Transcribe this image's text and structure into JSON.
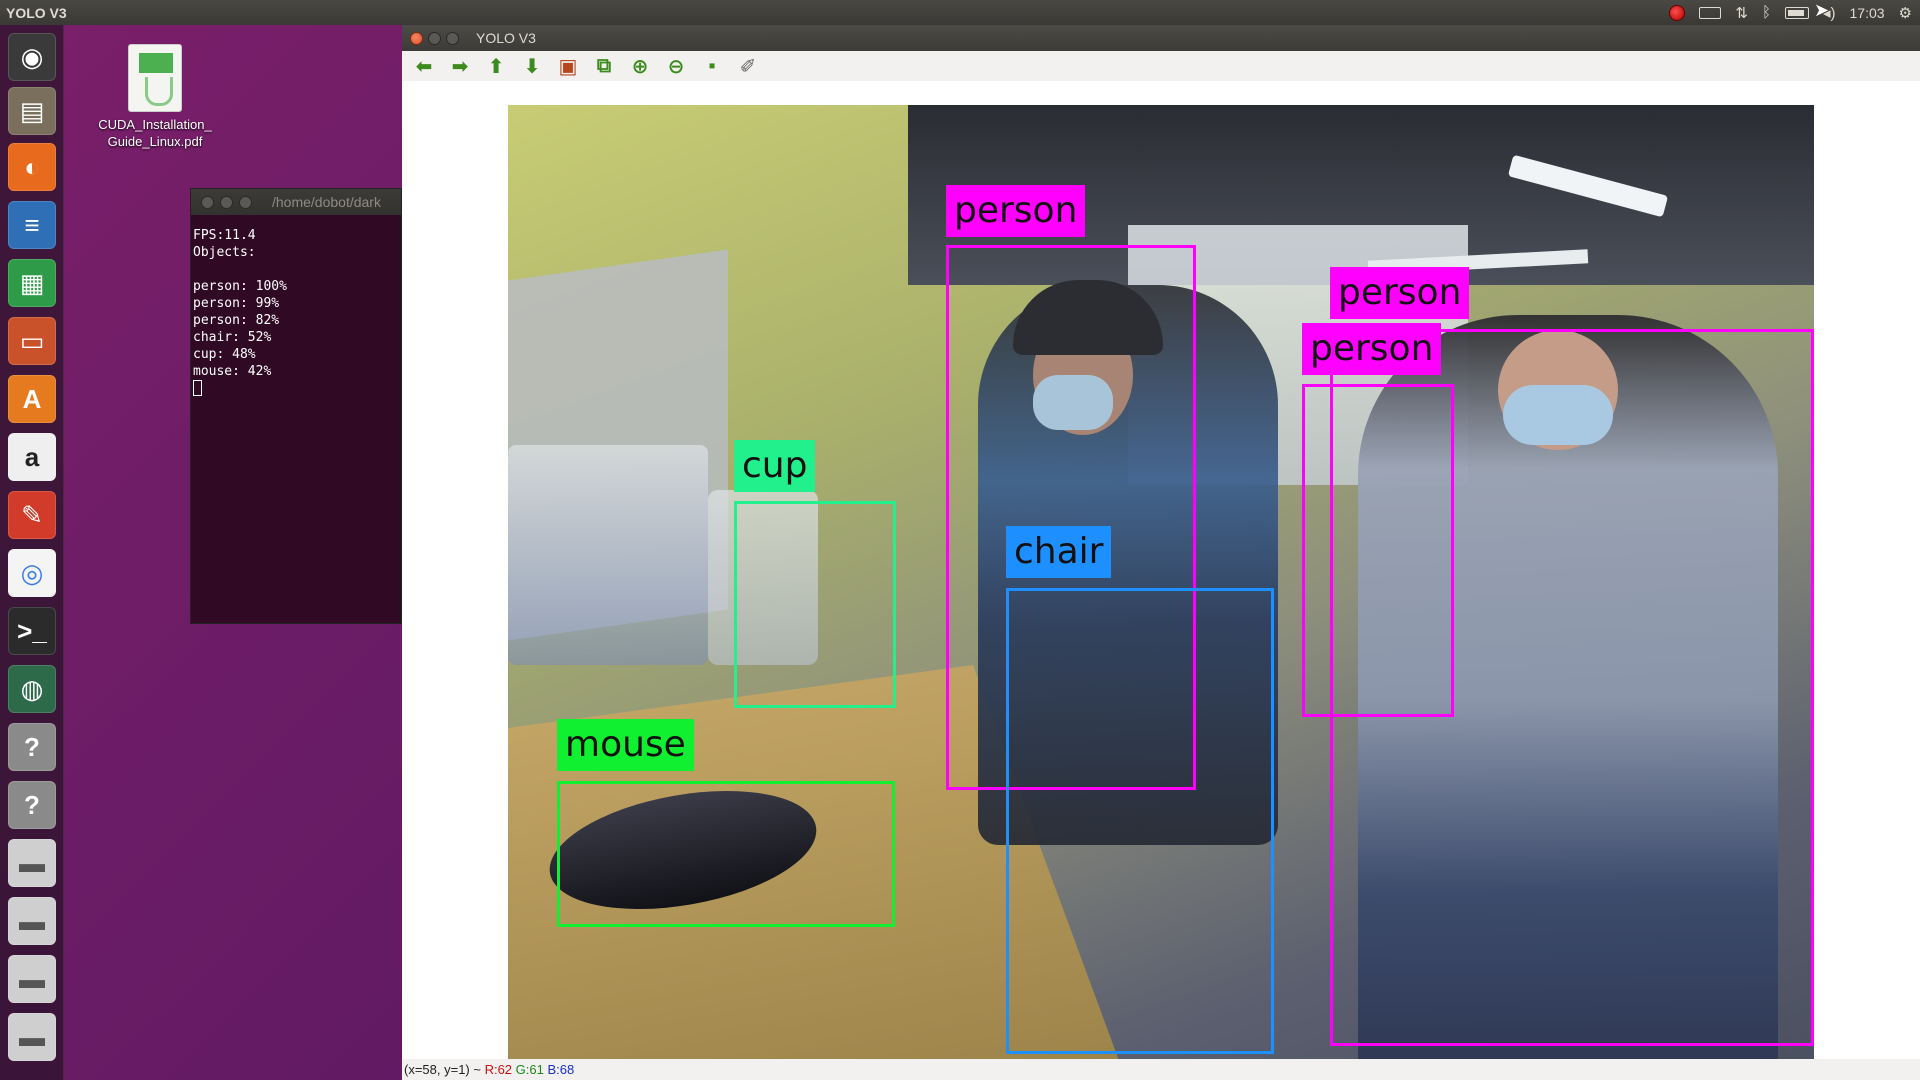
{
  "top_panel": {
    "app_title": "YOLO V3",
    "clock": "17:03",
    "indicators": [
      "record-icon",
      "keyboard-icon",
      "network-icon",
      "bluetooth-icon",
      "battery-icon",
      "volume-icon",
      "gear-icon"
    ]
  },
  "launcher": {
    "items": [
      "ubuntu-dash-icon",
      "files-icon",
      "firefox-icon",
      "writer-icon",
      "calc-icon",
      "impress-icon",
      "software-center-icon",
      "amazon-icon",
      "system-settings-icon",
      "chrome-icon",
      "terminal-icon",
      "globe-icon",
      "unknown-app-icon",
      "unknown-app-icon",
      "drive-icon",
      "drive-icon",
      "drive-icon",
      "drive-icon"
    ]
  },
  "desktop": {
    "file_name": "CUDA_Installation_\nGuide_Linux.pdf"
  },
  "terminal": {
    "title": "/home/dobot/dark",
    "lines": "FPS:11.4\nObjects:\n\nperson: 100%\nperson: 99%\nperson: 82%\nchair: 52%\ncup: 48%\nmouse: 42%"
  },
  "yolo_window": {
    "title": "YOLO V3",
    "toolbar": [
      "left-arrow-icon",
      "right-arrow-icon",
      "up-arrow-icon",
      "down-arrow-icon",
      "image-icon",
      "zoom-fit-icon",
      "zoom-in-icon",
      "zoom-out-icon",
      "save-icon",
      "brush-icon"
    ],
    "status": {
      "coords": "(x=58, y=1) ~ ",
      "r": "R:62",
      "g": "G:61",
      "b": "B:68"
    }
  },
  "detections": [
    {
      "label": "person",
      "color": "#ff00ff"
    },
    {
      "label": "person",
      "color": "#ff00ff"
    },
    {
      "label": "person",
      "color": "#ff00ff"
    },
    {
      "label": "chair",
      "color": "#1e8fff"
    },
    {
      "label": "cup",
      "color": "#22f08c"
    },
    {
      "label": "mouse",
      "color": "#11f030"
    }
  ]
}
